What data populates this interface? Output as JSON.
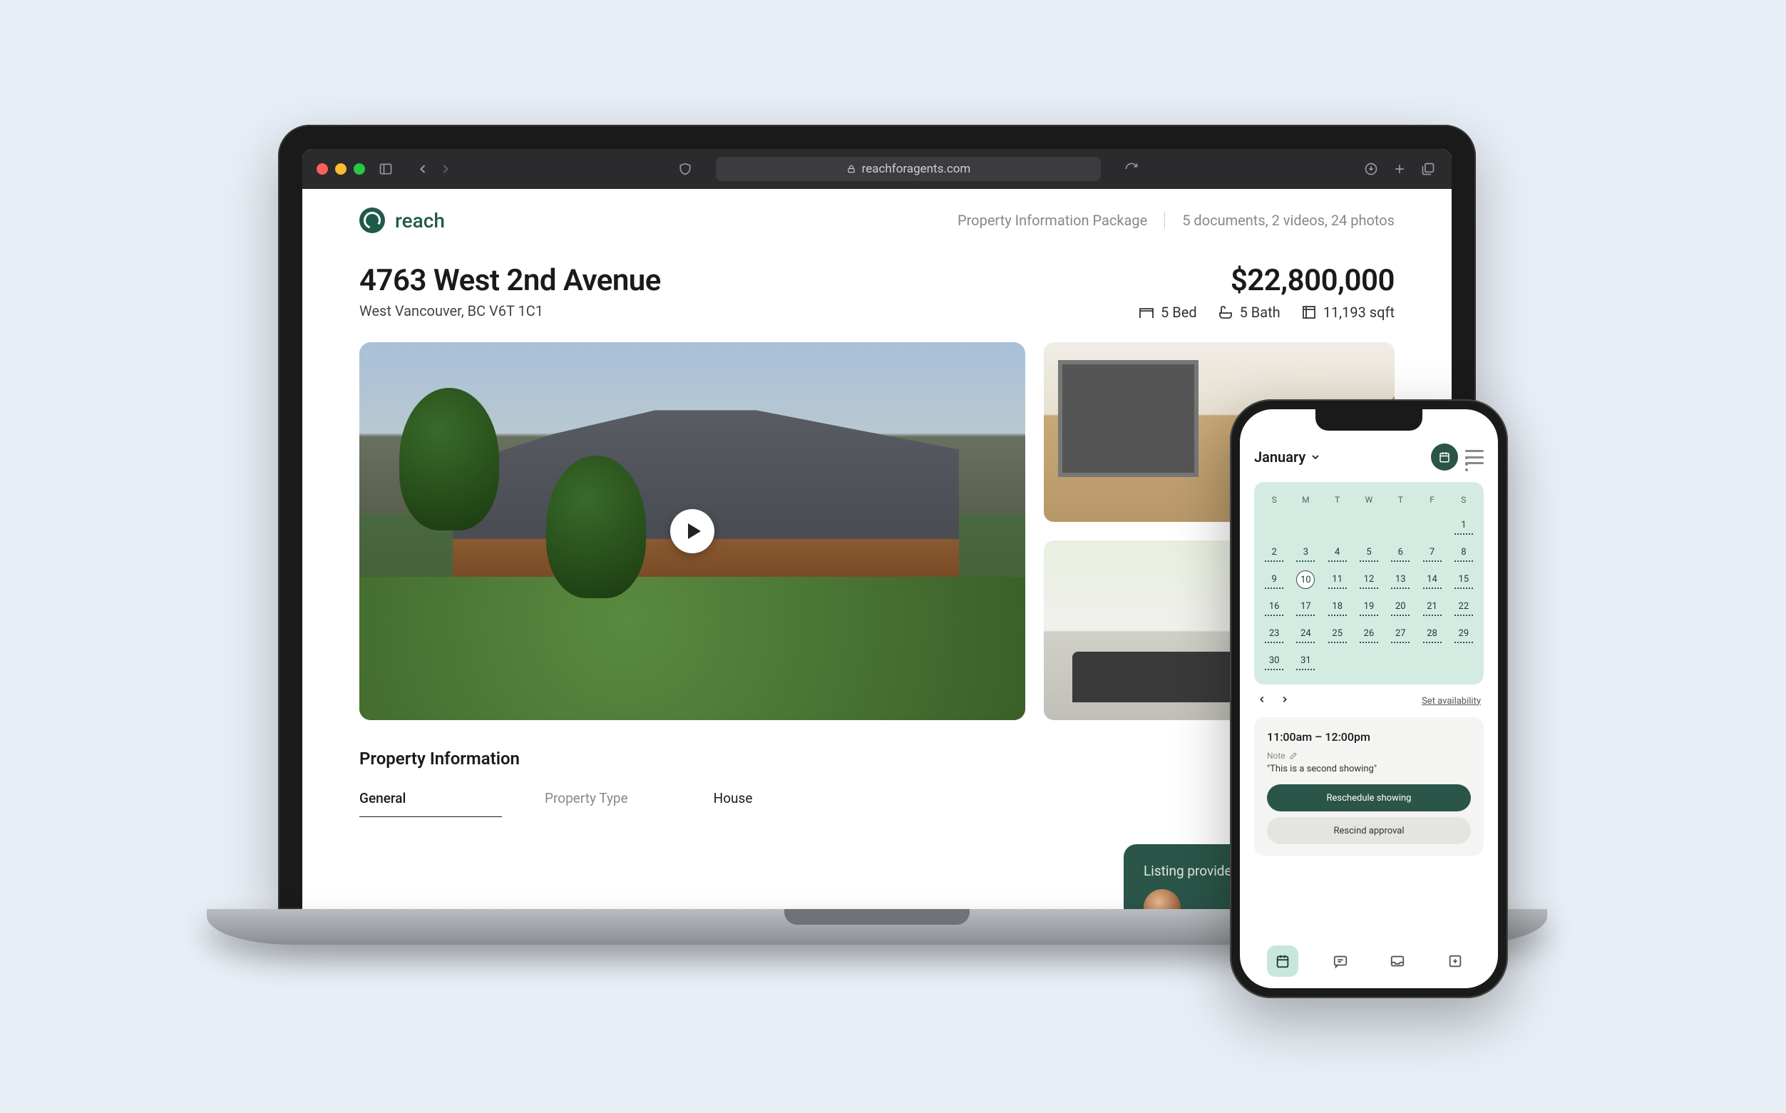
{
  "browser": {
    "url_display": "reachforagents.com"
  },
  "brand": {
    "name": "reach"
  },
  "top_right": {
    "pkg_label": "Property Information Package",
    "counts": "5 documents, 2 videos, 24 photos"
  },
  "listing": {
    "address": "4763 West 2nd Avenue",
    "locality": "West Vancouver, BC V6T 1C1",
    "price": "$22,800,000",
    "stats": {
      "bed": "5 Bed",
      "bath": "5 Bath",
      "sqft": "11,193 sqft"
    }
  },
  "section": {
    "info_title": "Property Information"
  },
  "general": {
    "tab": "General",
    "field_label": "Property Type",
    "field_value": "House"
  },
  "agent_card": {
    "title": "Listing provided by"
  },
  "phone": {
    "month": "January",
    "dow": [
      "S",
      "M",
      "T",
      "W",
      "T",
      "F",
      "S"
    ],
    "weeks": [
      [
        "",
        "",
        "",
        "",
        "",
        "",
        "1"
      ],
      [
        "2",
        "3",
        "4",
        "5",
        "6",
        "7",
        "8"
      ],
      [
        "9",
        "10",
        "11",
        "12",
        "13",
        "14",
        "15"
      ],
      [
        "16",
        "17",
        "18",
        "19",
        "20",
        "21",
        "22"
      ],
      [
        "23",
        "24",
        "25",
        "26",
        "27",
        "28",
        "29"
      ],
      [
        "30",
        "31",
        "",
        "",
        "",
        "",
        ""
      ]
    ],
    "selected_day": "10",
    "set_availability": "Set availability",
    "appt": {
      "time": "11:00am – 12:00pm",
      "note_label": "Note",
      "note": "\"This is a second showing\"",
      "reschedule": "Reschedule showing",
      "rescind": "Rescind approval"
    }
  }
}
